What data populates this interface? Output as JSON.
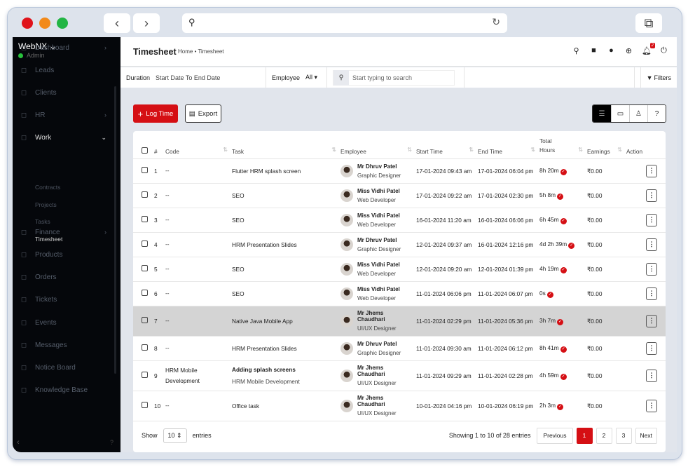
{
  "sidebar": {
    "brand": "WebNX",
    "role": "Admin",
    "items": [
      {
        "label": "Dashboard",
        "icon": "home-icon",
        "chev": true
      },
      {
        "label": "Leads",
        "icon": "user-icon"
      },
      {
        "label": "Clients",
        "icon": "building-icon"
      },
      {
        "label": "HR",
        "icon": "users-icon",
        "chev": true
      },
      {
        "label": "Work",
        "icon": "briefcase-icon",
        "chev": true,
        "open": true
      },
      {
        "label": "Finance",
        "icon": "dollar-icon",
        "chev": true
      },
      {
        "label": "Products",
        "icon": "basket-icon"
      },
      {
        "label": "Orders",
        "icon": "cart-icon"
      },
      {
        "label": "Tickets",
        "icon": "headset-icon"
      },
      {
        "label": "Events",
        "icon": "calendar-icon"
      },
      {
        "label": "Messages",
        "icon": "message-icon"
      },
      {
        "label": "Notice Board",
        "icon": "clipboard-icon"
      },
      {
        "label": "Knowledge Base",
        "icon": "document-icon"
      }
    ],
    "sub": [
      "Contracts",
      "Projects",
      "Tasks",
      "Timesheet"
    ]
  },
  "header": {
    "title": "Timesheet",
    "breadcrumb": "Home • Timesheet",
    "notif_count": "2"
  },
  "filters": {
    "duration_label": "Duration",
    "duration_value": "Start Date To End Date",
    "employee_label": "Employee",
    "employee_value": "All",
    "search_placeholder": "Start typing to search",
    "filters_label": "Filters"
  },
  "actions": {
    "log_time": "Log Time",
    "export": "Export"
  },
  "table": {
    "headers": [
      "#",
      "Code",
      "Task",
      "Employee",
      "Start Time",
      "End Time",
      "Total Hours",
      "Earnings",
      "Action"
    ],
    "rows": [
      {
        "n": "1",
        "code": "--",
        "task": "Flutter HRM splash screen",
        "emp": "Mr Dhruv Patel",
        "role": "Graphic Designer",
        "start": "17-01-2024 09:43 am",
        "end": "17-01-2024 06:04 pm",
        "total": "8h 20m",
        "earn": "₹0.00"
      },
      {
        "n": "2",
        "code": "--",
        "task": "SEO",
        "emp": "Miss Vidhi Patel",
        "role": "Web Developer",
        "start": "17-01-2024 09:22 am",
        "end": "17-01-2024 02:30 pm",
        "total": "5h 8m",
        "earn": "₹0.00"
      },
      {
        "n": "3",
        "code": "--",
        "task": "SEO",
        "emp": "Miss Vidhi Patel",
        "role": "Web Developer",
        "start": "16-01-2024 11:20 am",
        "end": "16-01-2024 06:06 pm",
        "total": "6h 45m",
        "earn": "₹0.00"
      },
      {
        "n": "4",
        "code": "--",
        "task": "HRM Presentation Slides",
        "emp": "Mr Dhruv Patel",
        "role": "Graphic Designer",
        "start": "12-01-2024 09:37 am",
        "end": "16-01-2024 12:16 pm",
        "total": "4d 2h 39m",
        "earn": "₹0.00"
      },
      {
        "n": "5",
        "code": "--",
        "task": "SEO",
        "emp": "Miss Vidhi Patel",
        "role": "Web Developer",
        "start": "12-01-2024 09:20 am",
        "end": "12-01-2024 01:39 pm",
        "total": "4h 19m",
        "earn": "₹0.00"
      },
      {
        "n": "6",
        "code": "--",
        "task": "SEO",
        "emp": "Miss Vidhi Patel",
        "role": "Web Developer",
        "start": "11-01-2024 06:06 pm",
        "end": "11-01-2024 06:07 pm",
        "total": "0s",
        "earn": "₹0.00"
      },
      {
        "n": "7",
        "code": "--",
        "task": "Native Java Mobile App",
        "emp": "Mr Jhems Chaudhari",
        "role": "UI/UX Designer",
        "start": "11-01-2024 02:29 pm",
        "end": "11-01-2024 05:36 pm",
        "total": "3h 7m",
        "earn": "₹0.00",
        "hl": true
      },
      {
        "n": "8",
        "code": "--",
        "task": "HRM Presentation Slides",
        "emp": "Mr Dhruv Patel",
        "role": "Graphic Designer",
        "start": "11-01-2024 09:30 am",
        "end": "11-01-2024 06:12 pm",
        "total": "8h 41m",
        "earn": "₹0.00"
      },
      {
        "n": "9",
        "code": "HRM Mobile Development",
        "task": "Adding splash screens",
        "task_sub": "HRM Mobile Development",
        "emp": "Mr Jhems Chaudhari",
        "role": "UI/UX Designer",
        "start": "11-01-2024 09:29 am",
        "end": "11-01-2024 02:28 pm",
        "total": "4h 59m",
        "earn": "₹0.00"
      },
      {
        "n": "10",
        "code": "--",
        "task": "Office task",
        "emp": "Mr Jhems Chaudhari",
        "role": "UI/UX Designer",
        "start": "10-01-2024 04:16 pm",
        "end": "10-01-2024 06:19 pm",
        "total": "2h 3m",
        "earn": "₹0.00"
      }
    ]
  },
  "footer": {
    "show": "Show",
    "entries_value": "10",
    "entries": "entries",
    "info": "Showing 1 to 10 of 28 entries",
    "prev": "Previous",
    "pages": [
      "1",
      "2",
      "3"
    ],
    "next": "Next"
  },
  "colors": {
    "accent": "#d50f14",
    "sidebar": "#05070b"
  }
}
